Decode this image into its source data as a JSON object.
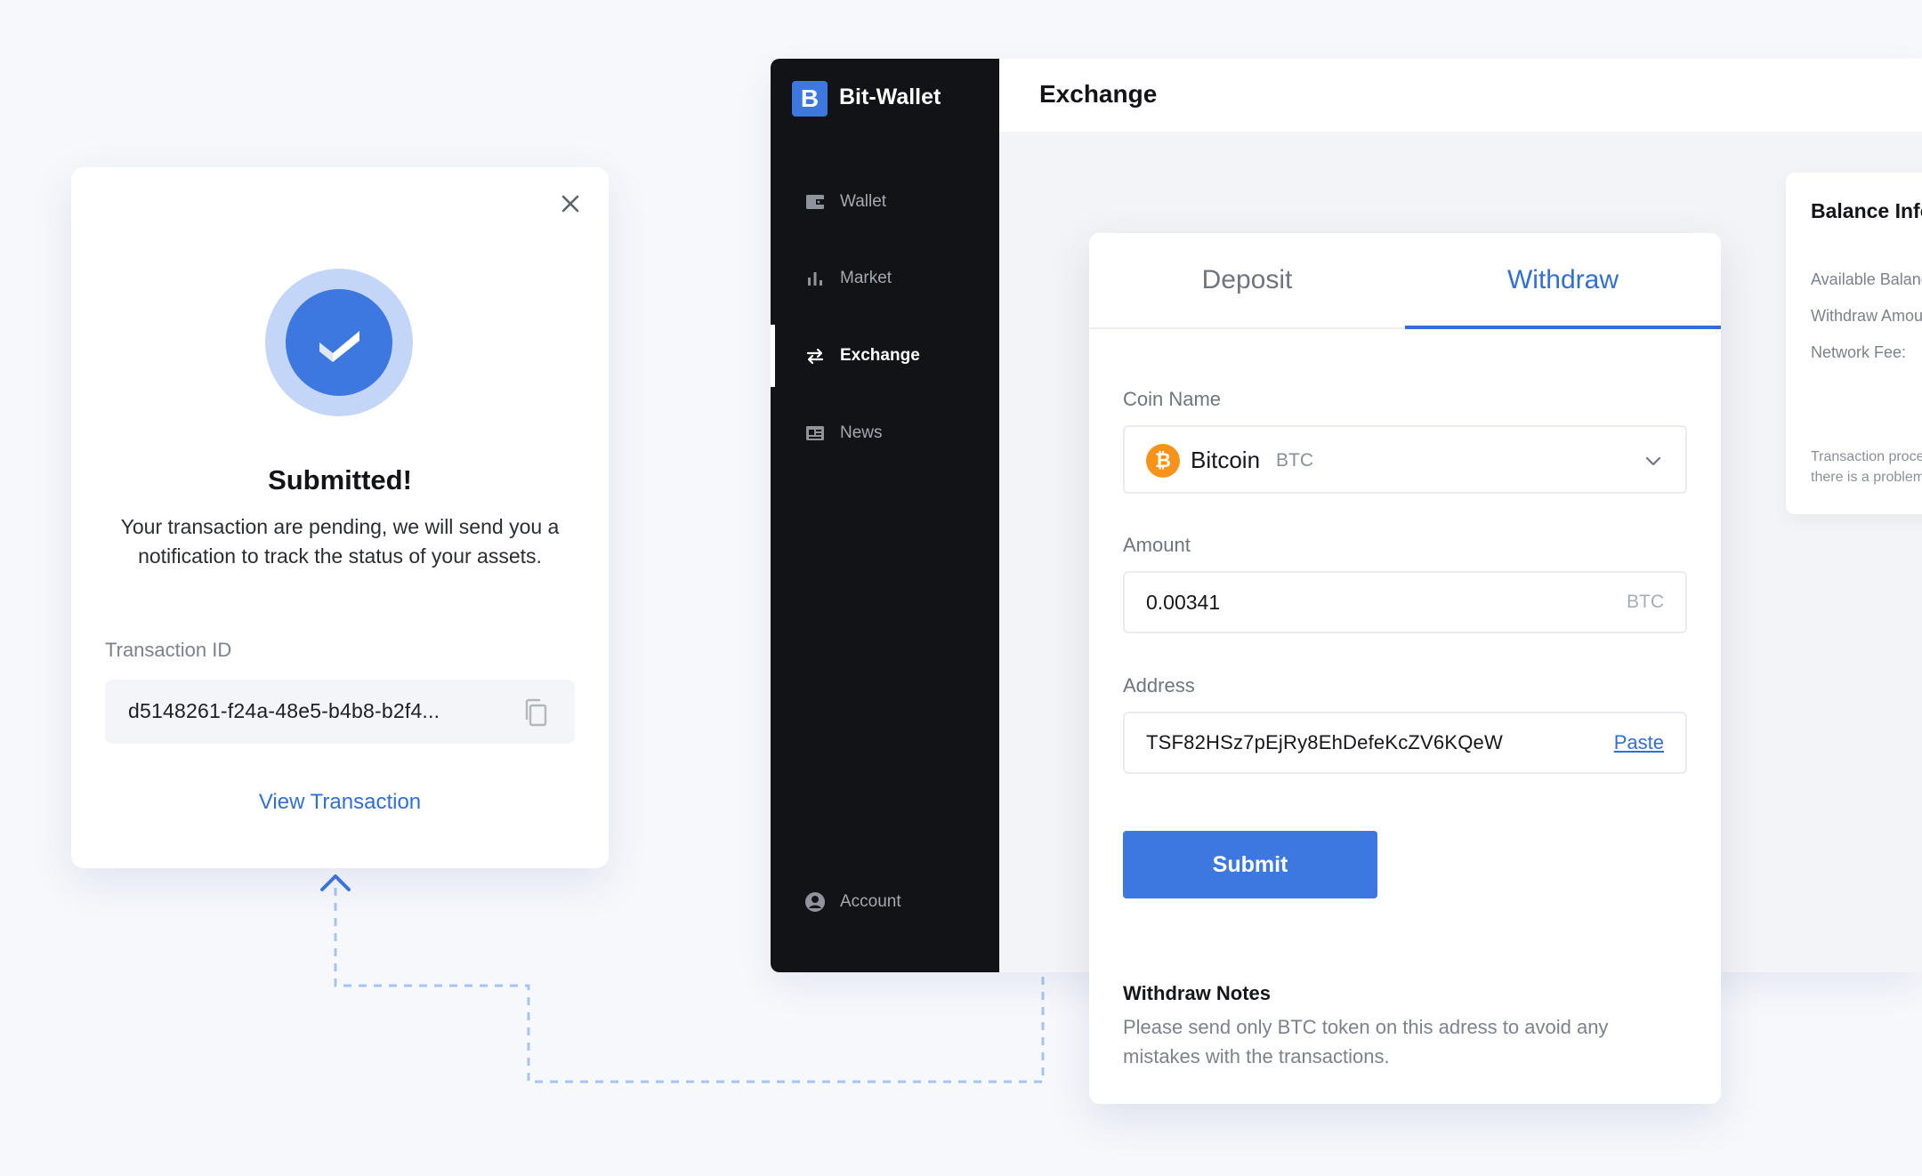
{
  "app": {
    "brand_letter": "B",
    "brand_name": "Bit-Wallet",
    "page_title": "Exchange",
    "accent_color": "#3d77e0"
  },
  "sidebar": {
    "items": [
      {
        "label": "Wallet",
        "icon": "wallet-icon"
      },
      {
        "label": "Market",
        "icon": "bar-chart-icon"
      },
      {
        "label": "Exchange",
        "icon": "exchange-arrows-icon",
        "active": true
      },
      {
        "label": "News",
        "icon": "newspaper-icon"
      }
    ],
    "account": {
      "label": "Account",
      "icon": "user-circle-icon"
    }
  },
  "modal": {
    "title": "Submitted!",
    "message": "Your transaction are pending, we will send you a notification to track the status of your assets.",
    "tx_label": "Transaction ID",
    "tx_value": "d5148261-f24a-48e5-b4b8-b2f4...",
    "view_link": "View Transaction"
  },
  "exchange": {
    "tabs": {
      "deposit": "Deposit",
      "withdraw": "Withdraw"
    },
    "active_tab": "Withdraw",
    "coin": {
      "label": "Coin Name",
      "name": "Bitcoin",
      "ticker": "BTC",
      "symbol": "₿"
    },
    "amount": {
      "label": "Amount",
      "value": "0.00341",
      "unit": "BTC"
    },
    "address": {
      "label": "Address",
      "value": "TSF82HSz7pEjRy8EhDefeKcZV6KQeW",
      "paste": "Paste"
    },
    "submit": "Submit",
    "notes": {
      "title": "Withdraw Notes",
      "text": "Please send only BTC token on this adress to avoid any mistakes with the transactions."
    }
  },
  "balance": {
    "title": "Balance Info",
    "rows": [
      "Available Balance:",
      "Withdraw Amount:",
      "Network Fee:"
    ],
    "note_line1": "Transaction process",
    "note_line2": "there is a problem"
  }
}
